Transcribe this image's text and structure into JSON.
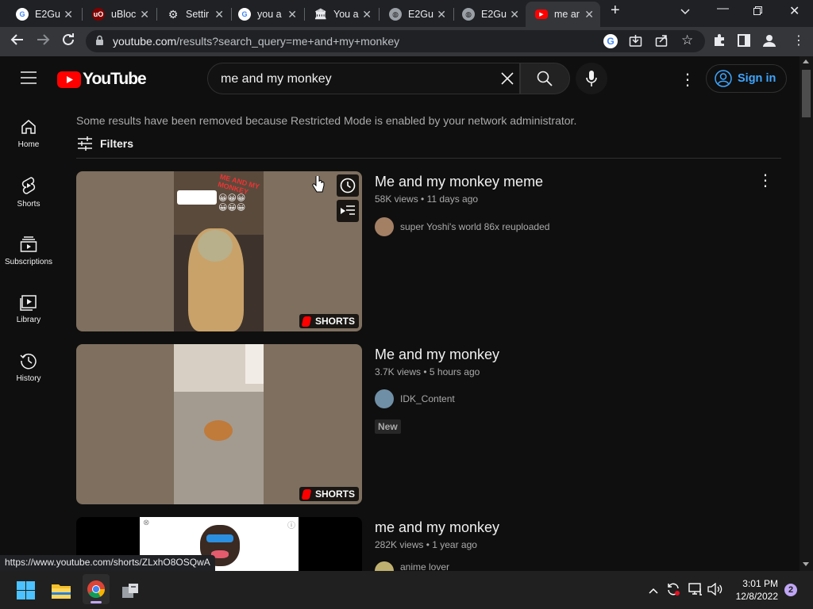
{
  "browser": {
    "tabs": [
      {
        "title": "E2Gu",
        "icon": "google-icon"
      },
      {
        "title": "uBloc",
        "icon": "ublock-icon"
      },
      {
        "title": "Settir",
        "icon": "gear-icon"
      },
      {
        "title": "you a",
        "icon": "google-icon"
      },
      {
        "title": "You a",
        "icon": "library-icon"
      },
      {
        "title": "E2Gu",
        "icon": "globe-icon"
      },
      {
        "title": "E2Gu",
        "icon": "globe-icon"
      },
      {
        "title": "me ar",
        "icon": "youtube-icon"
      }
    ],
    "url_host": "youtube.com",
    "url_path": "/results?search_query=me+and+my+monkey"
  },
  "masthead": {
    "logo_text": "YouTube",
    "search_value": "me and my monkey",
    "signin_label": "Sign in"
  },
  "sidebar": {
    "items": [
      {
        "label": "Home"
      },
      {
        "label": "Shorts"
      },
      {
        "label": "Subscriptions"
      },
      {
        "label": "Library"
      },
      {
        "label": "History"
      }
    ]
  },
  "results": {
    "notice": "Some results have been removed because Restricted Mode is enabled by your network administrator.",
    "filters_label": "Filters",
    "shorts_label": "SHORTS",
    "new_badge": "New",
    "videos": [
      {
        "title": "Me and my monkey meme",
        "views": "58K views",
        "age": "11 days ago",
        "channel": "super Yoshi's world 86x reuploaded"
      },
      {
        "title": "Me and my monkey",
        "views": "3.7K views",
        "age": "5 hours ago",
        "channel": "IDK_Content"
      },
      {
        "title": "me and my monkey",
        "views": "282K views",
        "age": "1 year ago",
        "channel": "anime lover"
      }
    ]
  },
  "status_url": "https://www.youtube.com/shorts/ZLxhO8OSQwA",
  "taskbar": {
    "time": "3:01 PM",
    "date": "12/8/2022",
    "notification_count": "2"
  },
  "colors": {
    "youtube_red": "#ff0000",
    "link_blue": "#3ea6ff",
    "background": "#0f0f0f"
  }
}
